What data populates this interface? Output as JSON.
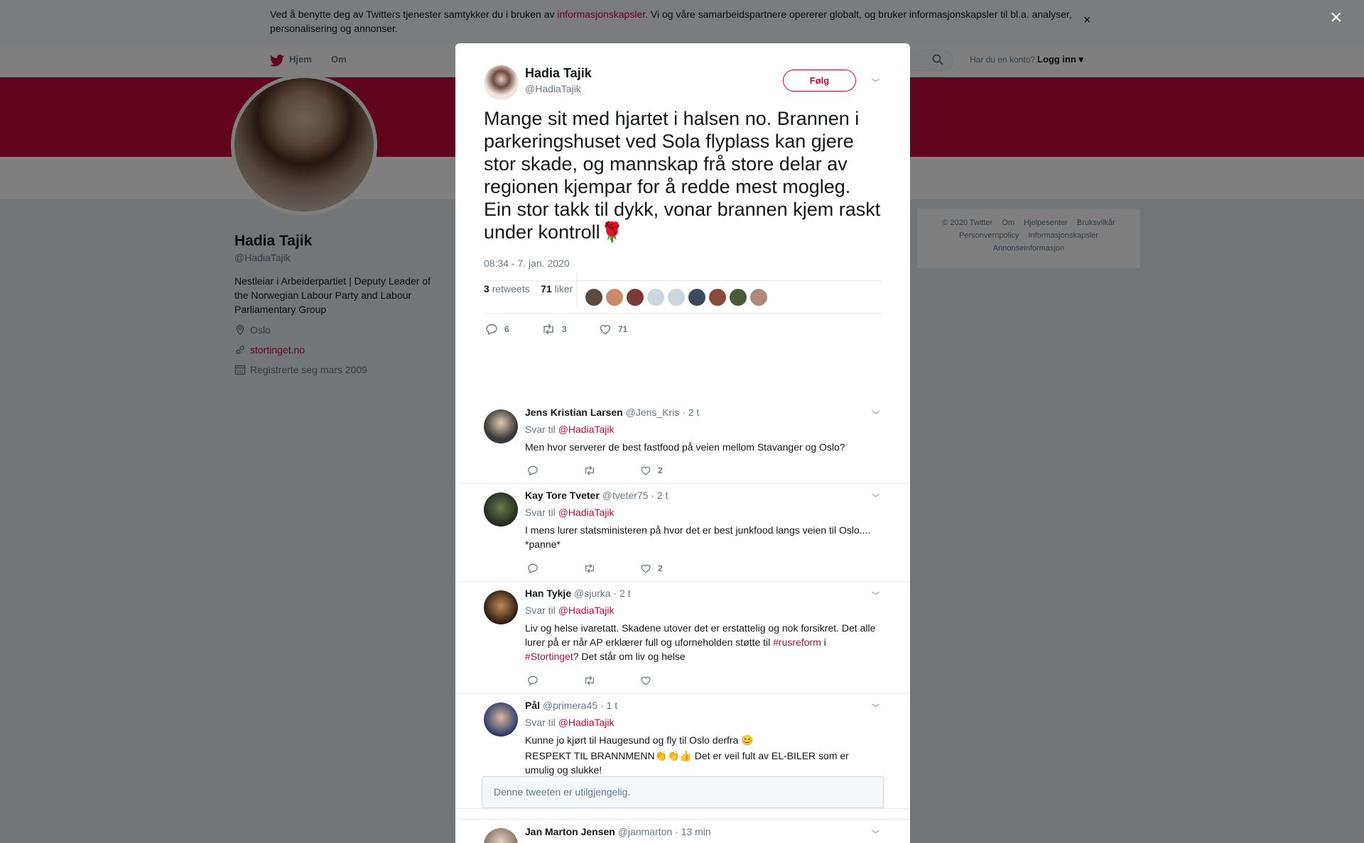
{
  "cookie_banner": {
    "text_before": "Ved å benytte deg av Twitters tjenester samtykker du i bruken av ",
    "link": "informasjonskapsler",
    "text_after": ". Vi og våre samarbeidspartnere opererer globalt, og bruker informasjonskapsler til bl.a. analyser, personalisering og annonser.",
    "close": "×"
  },
  "topnav": {
    "home": "Hjem",
    "about": "Om",
    "login_question": "Har du en konto?",
    "login": "Logg inn"
  },
  "profile": {
    "name": "Hadia Tajik",
    "handle": "@HadiaTajik",
    "bio": "Nestleiar i Arbeiderpartiet | Deputy Leader of the Norwegian Labour Party and Labour Parliamentary Group",
    "location": "Oslo",
    "website": "stortinget.no",
    "joined": "Registrerte seg mars 2009"
  },
  "footer": {
    "row1": [
      "© 2020 Twitter",
      "Om",
      "Hjelpesenter",
      "Bruksvilkår"
    ],
    "row2": [
      "Personvernpolicy",
      "Informasjonskapsler"
    ],
    "row3": "Annonseinformasjon"
  },
  "overlay_close": "×",
  "tweet": {
    "name": "Hadia Tajik",
    "handle": "@HadiaTajik",
    "follow": "Følg",
    "text": "Mange sit med hjartet i halsen no. Brannen i parkeringshuset ved Sola flyplass kan gjere stor skade, og mannskap frå store delar av regionen kjempar for å redde mest mogleg. Ein stor takk til dykk, vonar brannen kjem raskt under kontroll",
    "emoji": "🌹",
    "timestamp": "08:34 - 7. jan. 2020",
    "retweets_count": "3",
    "retweets_label": "retweets",
    "likes_count": "71",
    "likes_label": "liker",
    "action_replies": "6",
    "action_retweets": "3",
    "action_likes": "71"
  },
  "reply_to_label": "Svar til",
  "reply_to_handle": "@HadiaTajik",
  "replies": [
    {
      "name": "Jens Kristian Larsen",
      "handle": "@Jens_Kris",
      "time": "· 2 t",
      "text": "Men hvor serverer de best fastfood på veien mellom Stavanger og Oslo?",
      "likes": "2"
    },
    {
      "name": "Kay Tore Tveter",
      "handle": "@tveter75",
      "time": "· 2 t",
      "text": "I mens lurer statsministeren på hvor det er best junkfood langs veien til Oslo.... *panne*",
      "likes": "2"
    },
    {
      "name": "Han Tykje",
      "handle": "@sjurka",
      "time": "· 2 t",
      "text_a": "Liv og helse ivaretatt. Skadene utover det er erstattelig og nok forsikret. Det alle lurer på er når AP erklærer full og uforneholden støtte til ",
      "tag1": "#rusreform",
      "text_b": " i ",
      "tag2": "#Stortinget",
      "text_c": "? Det står om liv og helse",
      "likes": ""
    },
    {
      "name": "Pål",
      "handle": "@primera45",
      "time": "· 1 t",
      "line1": "Kunne jo kjørt til Haugesund og fly til Oslo derfra 😊",
      "line2": "RESPEKT TIL BRANNMENN👏👏👍 Det er veil fult av EL-BILER som er umulig og slukke!",
      "likes": ""
    },
    {
      "name": "Jan Marton Jensen",
      "handle": "@janmarton",
      "time": "· 13 min"
    }
  ],
  "unavailable": "Denne tweeten er utilgjengelig.",
  "colors": {
    "accent": "#c30a3c",
    "muted": "#657786"
  }
}
